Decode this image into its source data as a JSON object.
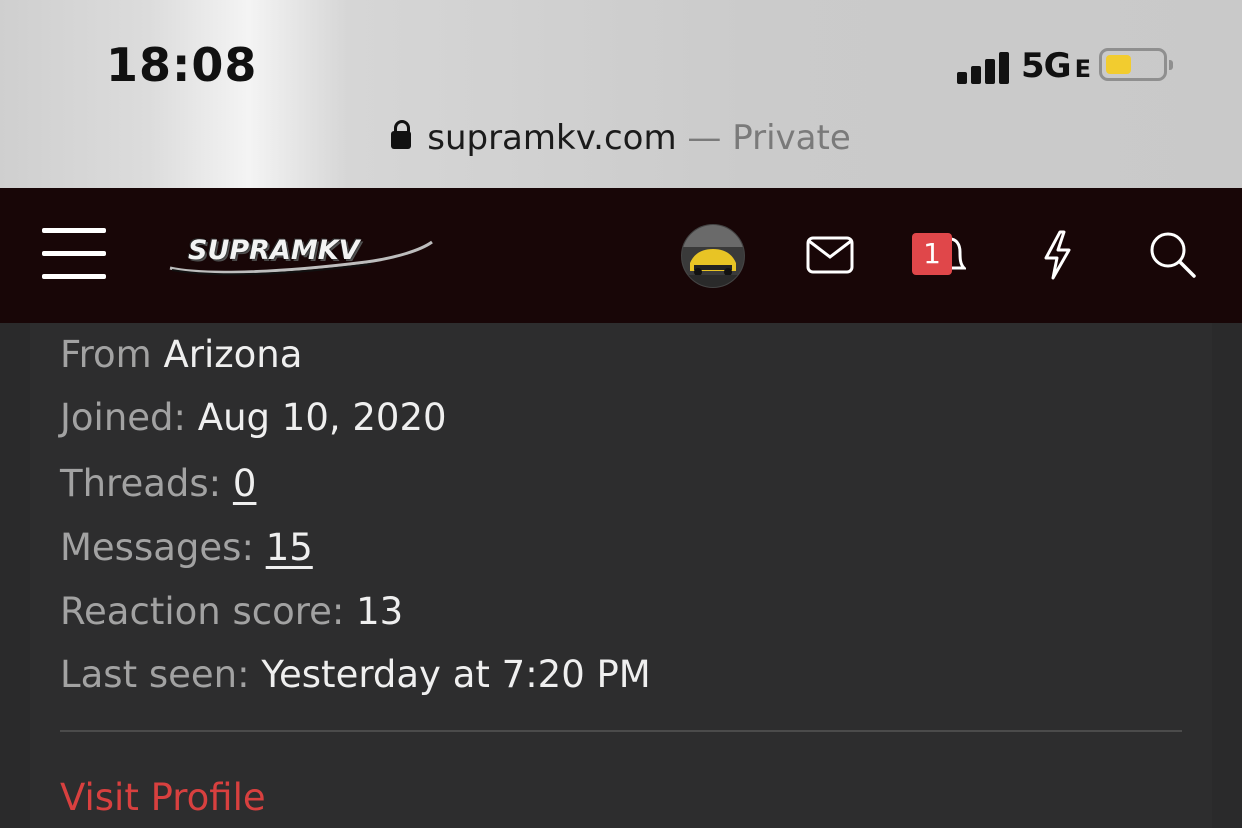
{
  "status_bar": {
    "time": "18:08",
    "network": "5G",
    "network_suffix": "E"
  },
  "url_bar": {
    "domain": "supramkv.com",
    "mode": "— Private"
  },
  "nav": {
    "logo_text": "SUPRAMKV",
    "notification_count": "1",
    "icons": [
      "menu-icon",
      "avatar",
      "mail-icon",
      "bell-icon",
      "lightning-icon",
      "search-icon"
    ]
  },
  "profile": {
    "from_label": "From",
    "from_value": "Arizona",
    "joined_label": "Joined:",
    "joined_value": "Aug 10, 2020",
    "threads_label": "Threads:",
    "threads_value": "0",
    "messages_label": "Messages:",
    "messages_value": "15",
    "reaction_label": "Reaction score:",
    "reaction_value": "13",
    "last_seen_label": "Last seen:",
    "last_seen_value": "Yesterday at 7:20 PM",
    "visit_profile": "Visit Profile"
  },
  "colors": {
    "navbar_bg": "#180607",
    "page_bg": "#2a2a2b",
    "link_red": "#d8403f",
    "badge_red": "#e0474a",
    "battery_yellow": "#f2cc2f"
  }
}
